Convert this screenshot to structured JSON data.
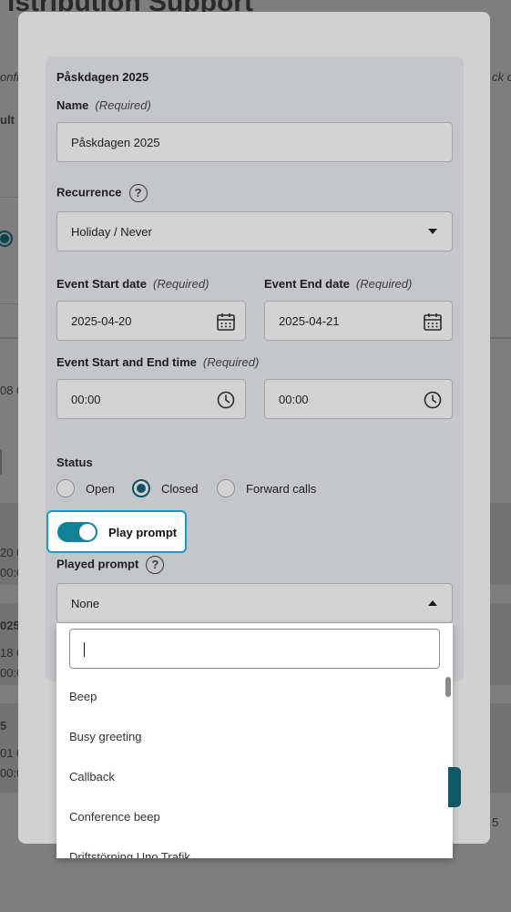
{
  "background": {
    "title": "istribution Support",
    "desc_left": "onfigu",
    "desc_right": "ck or",
    "col_left": "ult v",
    "rows": [
      {
        "date": "08 0"
      },
      {
        "title": "",
        "date": "20 0",
        "time": "00:0"
      },
      {
        "title": "025",
        "date": "18 0",
        "time": "00:0"
      },
      {
        "title": "5",
        "date": "01 0",
        "time": "00:0"
      }
    ],
    "page_num": "5"
  },
  "modal": {
    "section_title": "Påskdagen 2025",
    "name": {
      "label": "Name",
      "required": "(Required)",
      "value": "Påskdagen 2025"
    },
    "recurrence": {
      "label": "Recurrence",
      "value": "Holiday / Never"
    },
    "start_date": {
      "label": "Event Start date",
      "required": "(Required)",
      "value": "2025-04-20"
    },
    "end_date": {
      "label": "Event End date",
      "required": "(Required)",
      "value": "2025-04-21"
    },
    "time": {
      "label": "Event Start and End time",
      "required": "(Required)",
      "start": "00:00",
      "end": "00:00"
    },
    "status": {
      "label": "Status",
      "options": [
        "Open",
        "Closed",
        "Forward calls"
      ],
      "selected": "Closed"
    },
    "play_prompt": {
      "label": "Play prompt",
      "on": true
    },
    "played_prompt": {
      "label": "Played prompt",
      "value": "None",
      "search_value": "",
      "options": [
        "Beep",
        "Busy greeting",
        "Callback",
        "Conference beep",
        "Driftstörning Uno Trafik"
      ]
    }
  },
  "colors": {
    "accent": "#138197",
    "focus": "#1899c7",
    "radio": "#0c5364"
  },
  "icons": [
    "help-icon",
    "calendar-icon",
    "clock-icon",
    "chevron-down-icon",
    "chevron-up-icon"
  ]
}
